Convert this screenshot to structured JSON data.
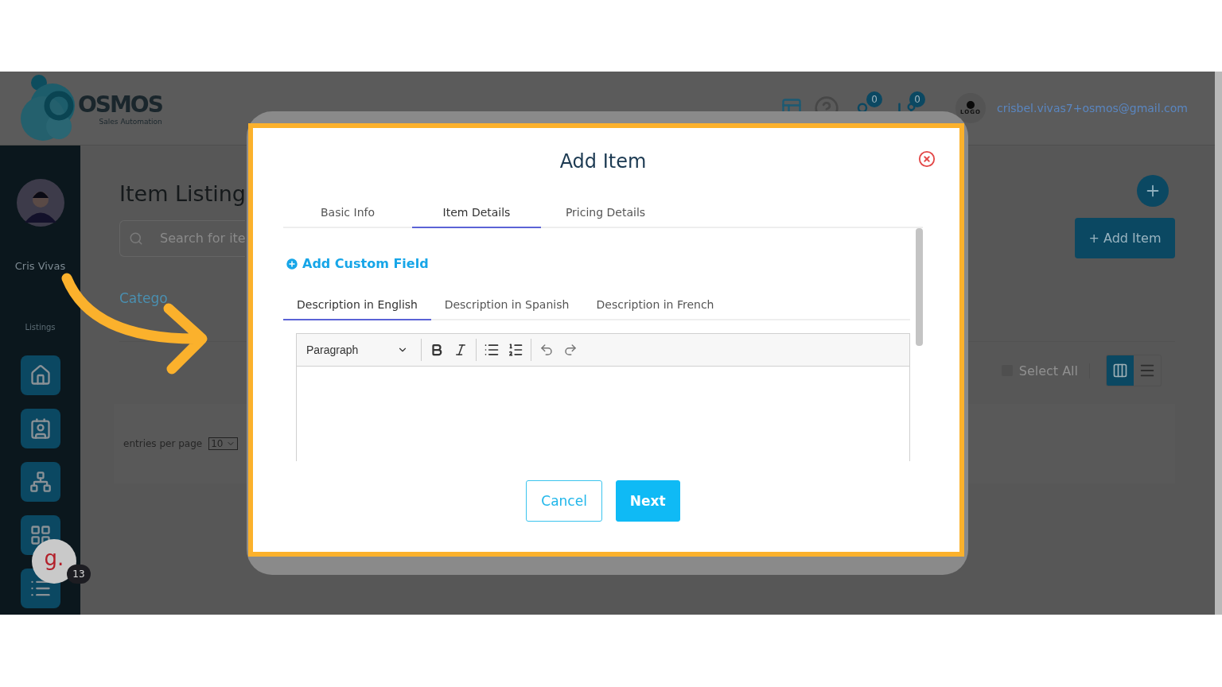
{
  "header": {
    "logo_text": "OSMOS",
    "logo_subtitle": "Sales Automation",
    "badges": [
      "0",
      "0"
    ],
    "avatar_text": "LOGO",
    "user_email": "crisbel.vivas7+osmos@gmail.com"
  },
  "sidebar": {
    "user_name": "Cris Vivas",
    "section": "Listings"
  },
  "chat_widget": {
    "letter": "g.",
    "count": "13"
  },
  "page": {
    "title": "Item Listing",
    "search": {
      "placeholder": "Search for ite"
    },
    "category_tab": "Catego",
    "add_button": "+ Add Item",
    "select_all": {
      "label": "Select All",
      "checked": false
    },
    "view_toggle": [
      {
        "kind": "grid",
        "selected": true
      },
      {
        "kind": "list",
        "selected": false
      }
    ],
    "entries_label": "entries per page",
    "entries_value": "10"
  },
  "modal": {
    "title": "Add Item",
    "tabs": [
      {
        "label": "Basic Info",
        "selected": false
      },
      {
        "label": "Item Details",
        "selected": true
      },
      {
        "label": "Pricing Details",
        "selected": false
      }
    ],
    "add_custom_field": "Add Custom Field",
    "description_tabs": [
      {
        "label": "Description in English",
        "selected": true
      },
      {
        "label": "Description in Spanish",
        "selected": false
      },
      {
        "label": "Description in French",
        "selected": false
      }
    ],
    "editor": {
      "block_style": "Paragraph"
    },
    "buttons": [
      {
        "kind": "secondary",
        "label": "Cancel"
      },
      {
        "kind": "primary",
        "label": "Next"
      }
    ]
  }
}
